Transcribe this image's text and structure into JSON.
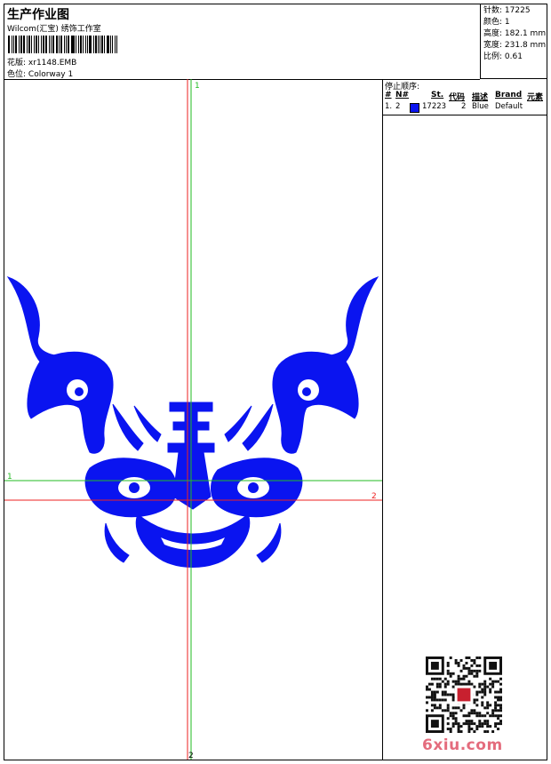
{
  "header": {
    "title": "生产作业图",
    "subtitle": "Wilcom(汇宝) 绣饰工作室",
    "design_label": "花版:",
    "design_value": "xr1148.EMB",
    "colorway_label": "色位:",
    "colorway_value": "Colorway 1"
  },
  "stats": [
    {
      "label": "针数:",
      "value": "17225"
    },
    {
      "label": "颜色:",
      "value": "1"
    },
    {
      "label": "高度:",
      "value": "182.1 mm"
    },
    {
      "label": "宽度:",
      "value": "231.8 mm"
    },
    {
      "label": "比例:",
      "value": "0.61"
    }
  ],
  "canvas": {
    "marker_top": "1",
    "marker_bottom": "2",
    "marker_left": "1",
    "marker_right": "2",
    "design_color": "#0a14f0",
    "guide_green": "#22bb22",
    "guide_red": "#ee2222"
  },
  "stop_sequence": {
    "title": "停止顺序:",
    "columns": [
      "#",
      "N#",
      "St.",
      "代码",
      "描述",
      "Brand",
      "元素"
    ],
    "rows": [
      {
        "index": "1.",
        "needle": "2",
        "color": "#0a14f0",
        "stitches": "17223",
        "code": "2",
        "description": "Blue",
        "brand": "Default",
        "element": ""
      }
    ]
  },
  "watermark": {
    "site": "6xiu.com",
    "color": "#e46c7d"
  }
}
